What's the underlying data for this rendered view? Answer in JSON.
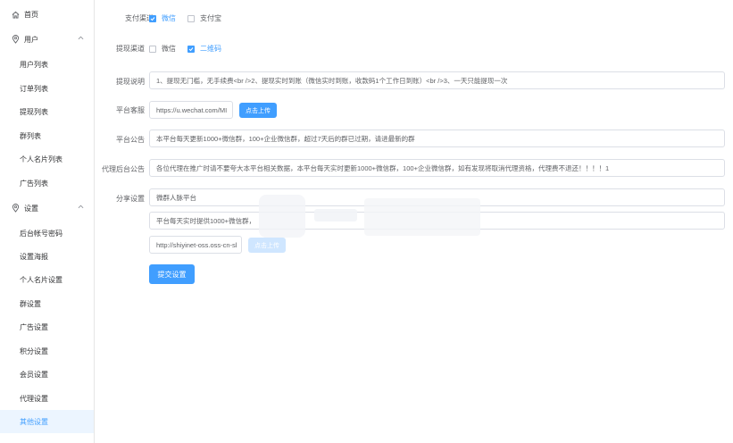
{
  "sidebar": {
    "home": "首页",
    "user_group": "用户",
    "user_items": [
      "用户列表",
      "订单列表",
      "提现列表",
      "群列表",
      "个人名片列表",
      "广告列表"
    ],
    "settings_group": "设置",
    "settings_items": [
      "后台帐号密码",
      "设置海报",
      "个人名片设置",
      "群设置",
      "广告设置",
      "积分设置",
      "会员设置",
      "代理设置",
      "其他设置"
    ],
    "active_item": "其他设置"
  },
  "form": {
    "pay_channel": {
      "label": "支付渠道",
      "options": [
        {
          "text": "微信",
          "checked": true
        },
        {
          "text": "支付宝",
          "checked": false
        }
      ]
    },
    "withdraw_channel": {
      "label": "提现渠道",
      "options": [
        {
          "text": "微信",
          "checked": false
        },
        {
          "text": "二维码",
          "checked": true
        }
      ]
    },
    "withdraw_desc": {
      "label": "提现说明",
      "value": "1、提现无门槛，无手续费<br />2、提现实时到账（微信实时到账，收款码1个工作日到账）<br />3、一天只能提现一次"
    },
    "platform_service": {
      "label": "平台客服",
      "value": "https://u.wechat.com/MI",
      "upload_button": "点击上传"
    },
    "platform_notice": {
      "label": "平台公告",
      "value": "本平台每天更新1000+微信群，100+企业微信群，超过7天后的群已过期，请进最新的群"
    },
    "agent_notice": {
      "label": "代理后台公告",
      "value": "各位代理在推广时请不要夸大本平台相关数据，本平台每天实时更新1000+微信群，100+企业微信群，如有发现将取消代理资格，代理费不退还！！！！1"
    },
    "share_settings": {
      "label": "分享设置",
      "title": "微群人脉平台",
      "desc": "平台每天实时提供1000+微信群，",
      "image_url": "http://shiyinet-oss.oss-cn-sl",
      "upload_button": "点击上传"
    },
    "submit_button": "提交设置"
  },
  "colors": {
    "accent": "#409eff",
    "active_bg": "#ecf5ff",
    "border": "#dcdfe6",
    "text": "#606266"
  }
}
